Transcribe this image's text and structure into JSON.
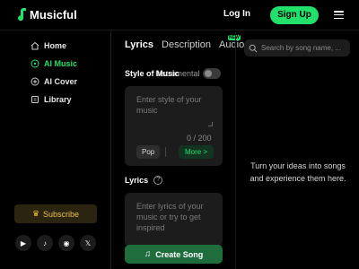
{
  "header": {
    "logo_text": "Musicful",
    "login_label": "Log In",
    "signup_label": "Sign Up",
    "accent_color": "#22e06a"
  },
  "sidebar": {
    "items": [
      {
        "label": "Home",
        "icon": "home-icon",
        "active": false
      },
      {
        "label": "AI Music",
        "icon": "music-disc-icon",
        "active": true
      },
      {
        "label": "AI Cover",
        "icon": "cover-icon",
        "active": false
      },
      {
        "label": "Library",
        "icon": "library-icon",
        "active": false
      }
    ],
    "subscribe_label": "Subscribe",
    "social": [
      {
        "name": "youtube-icon",
        "glyph": "▶"
      },
      {
        "name": "tiktok-icon",
        "glyph": "♪"
      },
      {
        "name": "discord-icon",
        "glyph": "◉"
      },
      {
        "name": "x-icon",
        "glyph": "𝕏"
      }
    ]
  },
  "main": {
    "tabs": [
      {
        "label": "Lyrics",
        "active": true
      },
      {
        "label": "Description",
        "active": false
      },
      {
        "label": "Audio",
        "active": false
      }
    ],
    "new_badge": "NEW",
    "style_label": "Style of Music",
    "instrumental_label": "Instrumental",
    "style_placeholder": "Enter style of your music",
    "style_counter": "0 / 200",
    "style_chip": "Pop",
    "more_label": "More >",
    "lyrics_label": "Lyrics",
    "lyrics_placeholder": "Enter lyrics of your music or try to get inspired",
    "create_label": "Create Song"
  },
  "right": {
    "search_placeholder": "Search by song name, ...",
    "empty_message": "Turn your ideas into songs and experience them here."
  }
}
